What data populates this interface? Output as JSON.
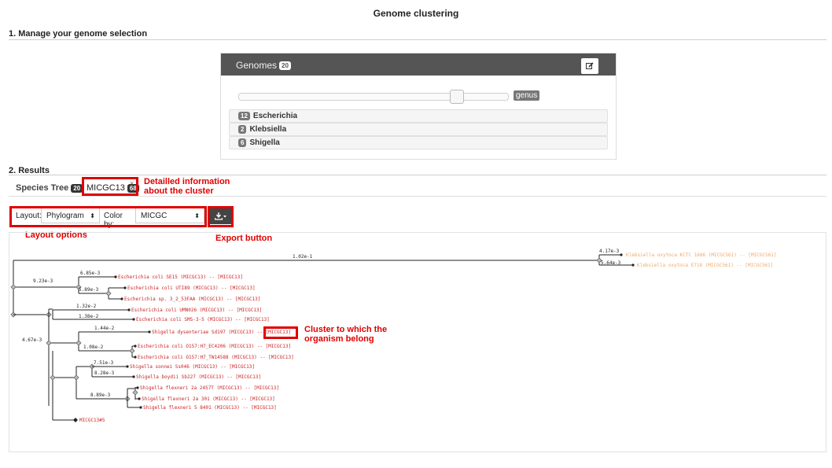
{
  "page_title": "Genome clustering",
  "section1": "1. Manage your genome selection",
  "section2": "2. Results",
  "genomes_panel": {
    "title": "Genomes",
    "count": "20",
    "edit_icon": "pencil-square-icon",
    "level_label": "genus",
    "slider_position": 0.85,
    "genera": [
      {
        "count": "12",
        "name": "Escherichia"
      },
      {
        "count": "2",
        "name": "Klebsiella"
      },
      {
        "count": "6",
        "name": "Shigella"
      }
    ]
  },
  "tabs": {
    "species": {
      "label": "Species Tree",
      "count": "20"
    },
    "cluster": {
      "label": "MICGC13",
      "count": "68"
    },
    "close_glyph": "×"
  },
  "toolbar": {
    "layout_label": "Layout:",
    "layout_value": "Phylogram",
    "color_label": "Color by:",
    "color_value": "MICGC",
    "caret": "⬍",
    "export_icon": "download-icon"
  },
  "annotations": {
    "cluster_info": "Detailled information\nabout the cluster",
    "layout_options": "Layout options",
    "export": "Export button",
    "cluster_belong": "Cluster to which the\norganism belong"
  },
  "colors": {
    "annotation": "#e00000",
    "leaf_red": "#cc2222",
    "leaf_orange": "#f2a866",
    "panel_header": "#555555"
  },
  "tree": {
    "leaves": [
      {
        "label": "Klebsiella oxytoca KCTC 1686 (MICGC561) -- [MICGC561]",
        "color": "orange"
      },
      {
        "label": "Klebsiella oxytoca E718 (MICGC561) -- [MICGC561]",
        "color": "orange"
      },
      {
        "label": "Escherichia coli SE15 (MICGC13) -- [MICGC13]",
        "color": "red"
      },
      {
        "label": "Escherichia coli UTI89 (MICGC13) -- [MICGC13]",
        "color": "red"
      },
      {
        "label": "Escherichia sp. 3_2_53FAA (MICGC13) -- [MICGC13]",
        "color": "red"
      },
      {
        "label": "Escherichia coli UMN026 (MICGC13) -- [MICGC13]",
        "color": "red"
      },
      {
        "label": "Escherichia coli SMS-3-5 (MICGC13) -- [MICGC13]",
        "color": "red"
      },
      {
        "label": "Shigella dysenteriae Sd197 (MICGC13) -- [MICGC13]",
        "color": "red"
      },
      {
        "label": "Escherichia coli O157:H7_EC4206 (MICGC13) -- [MICGC13]",
        "color": "red"
      },
      {
        "label": "Escherichia coli O157:H7_TW14588 (MICGC13) -- [MICGC13]",
        "color": "red"
      },
      {
        "label": "Shigella sonnei Ss046 (MICGC13) -- [MICGC13]",
        "color": "red"
      },
      {
        "label": "Shigella boydii Sb227 (MICGC13) -- [MICGC13]",
        "color": "red"
      },
      {
        "label": "Shigella flexneri 2a 2457T (MICGC13) -- [MICGC13]",
        "color": "red"
      },
      {
        "label": "Shigella flexneri 2a 301 (MICGC13) -- [MICGC13]",
        "color": "red"
      },
      {
        "label": "Shigella flexneri 5 8401 (MICGC13) -- [MICGC13]",
        "color": "red"
      },
      {
        "label": "MICGC13#5",
        "color": "red"
      }
    ],
    "branch_lengths": [
      "1.02e-1",
      "4.17e-3",
      "5.64e-3",
      "9.23e-3",
      "6.85e-3",
      "5.89e-3",
      "1.32e-2",
      "1.38e-2",
      "1.44e-2",
      "4.67e-3",
      "1.08e-2",
      "7.51e-3",
      "8.28e-3",
      "8.89e-3"
    ]
  }
}
